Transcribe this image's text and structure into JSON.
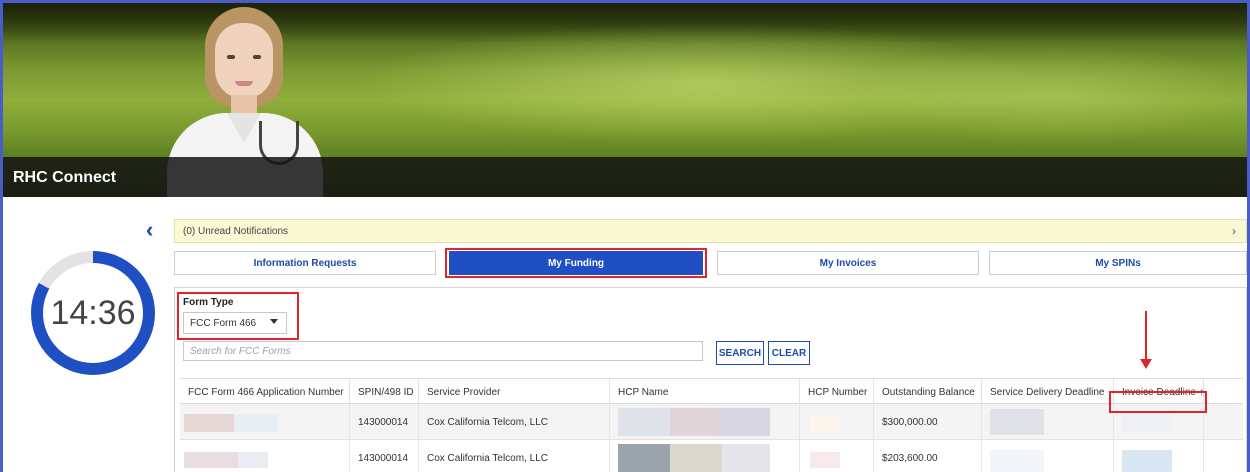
{
  "app": {
    "title": "RHC Connect"
  },
  "timer": {
    "value": "14:36",
    "remaining_fraction": 0.83
  },
  "notifications": {
    "label": "(0) Unread Notifications"
  },
  "tabs": [
    {
      "label": "Information Requests",
      "active": false
    },
    {
      "label": "My Funding",
      "active": true
    },
    {
      "label": "My Invoices",
      "active": false
    },
    {
      "label": "My SPINs",
      "active": false
    }
  ],
  "filter": {
    "form_type_label": "Form Type",
    "form_type_value": "FCC Form 466",
    "search_placeholder": "Search for FCC Forms",
    "search_button": "SEARCH",
    "clear_button": "CLEAR"
  },
  "table": {
    "columns": [
      "FCC Form 466 Application Number",
      "SPIN/498 ID",
      "Service Provider",
      "HCP Name",
      "HCP Number",
      "Outstanding Balance",
      "Service Delivery Deadline",
      "Invoice Deadline"
    ],
    "sort_indicator": "↑",
    "rows": [
      {
        "spin": "143000014",
        "provider": "Cox California Telcom, LLC",
        "balance": "$300,000.00"
      },
      {
        "spin": "143000014",
        "provider": "Cox California Telcom, LLC",
        "balance": "$203,600.00"
      }
    ]
  },
  "colors": {
    "primary": "#1f4fc2",
    "annotation": "#e0242b",
    "notification_bg": "#fbf8d4"
  }
}
